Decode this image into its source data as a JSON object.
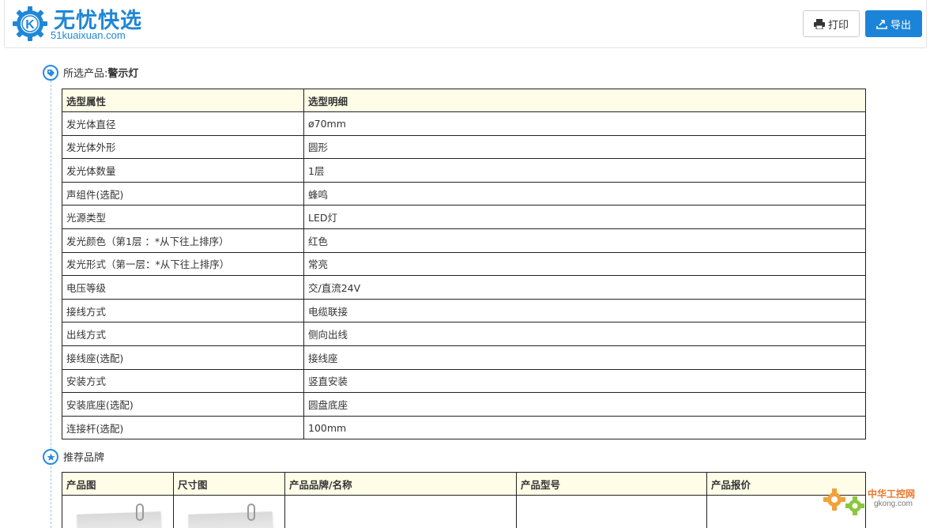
{
  "header": {
    "brand_cn": "无忧快选",
    "brand_en": "51kuaixuan.com",
    "logo_letter": "K",
    "print_label": "打印",
    "export_label": "导出",
    "accent_color": "#1c84d8"
  },
  "section1": {
    "prefix": "所选产品:",
    "product": "警示灯",
    "icon": "tag-icon"
  },
  "spec_table": {
    "headers": [
      "选型属性",
      "选型明细"
    ],
    "rows": [
      [
        "发光体直径",
        "ø70mm"
      ],
      [
        "发光体外形",
        "圆形"
      ],
      [
        "发光体数量",
        "1层"
      ],
      [
        "声组件(选配)",
        "蜂鸣"
      ],
      [
        "光源类型",
        "LED灯"
      ],
      [
        "发光颜色（第1层 ：*从下往上排序）",
        "红色"
      ],
      [
        "发光形式（第一层：*从下往上排序）",
        "常亮"
      ],
      [
        "电压等级",
        "交/直流24V"
      ],
      [
        "接线方式",
        "电缆联接"
      ],
      [
        "出线方式",
        "侧向出线"
      ],
      [
        "接线座(选配)",
        "接线座"
      ],
      [
        "安装方式",
        "竖直安装"
      ],
      [
        "安装底座(选配)",
        "圆盘底座"
      ],
      [
        "连接杆(选配)",
        "100mm"
      ]
    ]
  },
  "section2": {
    "title": "推荐品牌",
    "icon": "star-icon"
  },
  "brand_table": {
    "headers": [
      "产品图",
      "尺寸图",
      "产品品牌/名称",
      "产品型号",
      "产品报价"
    ]
  },
  "watermark": {
    "text": "中华工控网",
    "sub": "gkong.com"
  }
}
